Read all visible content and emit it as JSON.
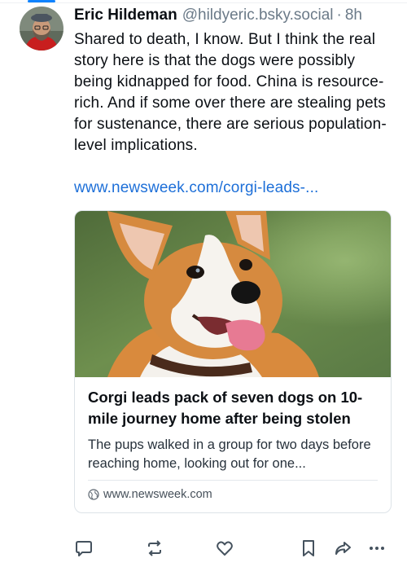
{
  "post": {
    "author_name": "Eric Hildeman",
    "author_handle": "@hildyeric.bsky.social",
    "separator": "·",
    "timestamp": "8h",
    "text": "Shared to death, I know. But I think the real story here is that the dogs were possibly being kidnapped for food. China is resource-rich. And if some over there are stealing pets for sustenance, there are serious population-level implications.",
    "link_text": "www.newsweek.com/corgi-leads-..."
  },
  "link_card": {
    "title": "Corgi leads pack of seven dogs on 10-mile journey home after being stolen",
    "description": "The pups walked in a group for two days before reaching home, looking out for one...",
    "source": "www.newsweek.com",
    "image": "corgi-photo"
  },
  "actions": {
    "icons": [
      "reply-icon",
      "repost-icon",
      "like-icon",
      "bookmark-icon",
      "share-icon",
      "more-icon"
    ]
  },
  "colors": {
    "accent": "#1083fe",
    "link": "#1d6fd8",
    "muted": "#6b7a88"
  }
}
